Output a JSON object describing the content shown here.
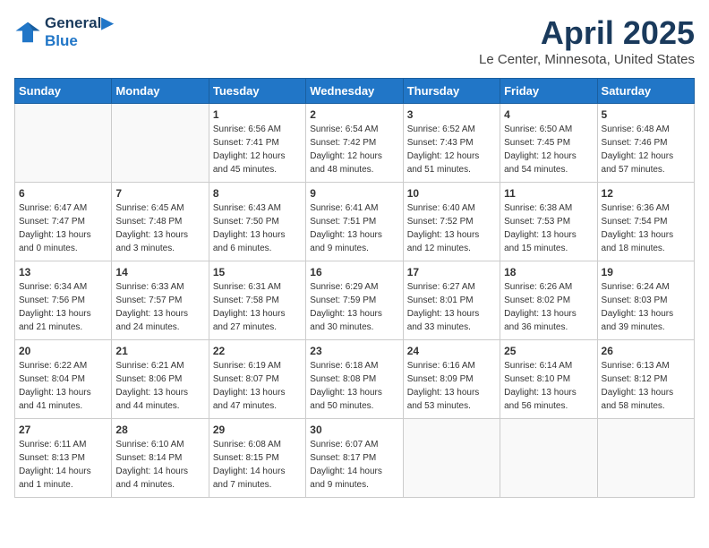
{
  "header": {
    "logo_line1": "General",
    "logo_line2": "Blue",
    "main_title": "April 2025",
    "subtitle": "Le Center, Minnesota, United States"
  },
  "days_of_week": [
    "Sunday",
    "Monday",
    "Tuesday",
    "Wednesday",
    "Thursday",
    "Friday",
    "Saturday"
  ],
  "weeks": [
    [
      {
        "day": "",
        "detail": ""
      },
      {
        "day": "",
        "detail": ""
      },
      {
        "day": "1",
        "detail": "Sunrise: 6:56 AM\nSunset: 7:41 PM\nDaylight: 12 hours and 45 minutes."
      },
      {
        "day": "2",
        "detail": "Sunrise: 6:54 AM\nSunset: 7:42 PM\nDaylight: 12 hours and 48 minutes."
      },
      {
        "day": "3",
        "detail": "Sunrise: 6:52 AM\nSunset: 7:43 PM\nDaylight: 12 hours and 51 minutes."
      },
      {
        "day": "4",
        "detail": "Sunrise: 6:50 AM\nSunset: 7:45 PM\nDaylight: 12 hours and 54 minutes."
      },
      {
        "day": "5",
        "detail": "Sunrise: 6:48 AM\nSunset: 7:46 PM\nDaylight: 12 hours and 57 minutes."
      }
    ],
    [
      {
        "day": "6",
        "detail": "Sunrise: 6:47 AM\nSunset: 7:47 PM\nDaylight: 13 hours and 0 minutes."
      },
      {
        "day": "7",
        "detail": "Sunrise: 6:45 AM\nSunset: 7:48 PM\nDaylight: 13 hours and 3 minutes."
      },
      {
        "day": "8",
        "detail": "Sunrise: 6:43 AM\nSunset: 7:50 PM\nDaylight: 13 hours and 6 minutes."
      },
      {
        "day": "9",
        "detail": "Sunrise: 6:41 AM\nSunset: 7:51 PM\nDaylight: 13 hours and 9 minutes."
      },
      {
        "day": "10",
        "detail": "Sunrise: 6:40 AM\nSunset: 7:52 PM\nDaylight: 13 hours and 12 minutes."
      },
      {
        "day": "11",
        "detail": "Sunrise: 6:38 AM\nSunset: 7:53 PM\nDaylight: 13 hours and 15 minutes."
      },
      {
        "day": "12",
        "detail": "Sunrise: 6:36 AM\nSunset: 7:54 PM\nDaylight: 13 hours and 18 minutes."
      }
    ],
    [
      {
        "day": "13",
        "detail": "Sunrise: 6:34 AM\nSunset: 7:56 PM\nDaylight: 13 hours and 21 minutes."
      },
      {
        "day": "14",
        "detail": "Sunrise: 6:33 AM\nSunset: 7:57 PM\nDaylight: 13 hours and 24 minutes."
      },
      {
        "day": "15",
        "detail": "Sunrise: 6:31 AM\nSunset: 7:58 PM\nDaylight: 13 hours and 27 minutes."
      },
      {
        "day": "16",
        "detail": "Sunrise: 6:29 AM\nSunset: 7:59 PM\nDaylight: 13 hours and 30 minutes."
      },
      {
        "day": "17",
        "detail": "Sunrise: 6:27 AM\nSunset: 8:01 PM\nDaylight: 13 hours and 33 minutes."
      },
      {
        "day": "18",
        "detail": "Sunrise: 6:26 AM\nSunset: 8:02 PM\nDaylight: 13 hours and 36 minutes."
      },
      {
        "day": "19",
        "detail": "Sunrise: 6:24 AM\nSunset: 8:03 PM\nDaylight: 13 hours and 39 minutes."
      }
    ],
    [
      {
        "day": "20",
        "detail": "Sunrise: 6:22 AM\nSunset: 8:04 PM\nDaylight: 13 hours and 41 minutes."
      },
      {
        "day": "21",
        "detail": "Sunrise: 6:21 AM\nSunset: 8:06 PM\nDaylight: 13 hours and 44 minutes."
      },
      {
        "day": "22",
        "detail": "Sunrise: 6:19 AM\nSunset: 8:07 PM\nDaylight: 13 hours and 47 minutes."
      },
      {
        "day": "23",
        "detail": "Sunrise: 6:18 AM\nSunset: 8:08 PM\nDaylight: 13 hours and 50 minutes."
      },
      {
        "day": "24",
        "detail": "Sunrise: 6:16 AM\nSunset: 8:09 PM\nDaylight: 13 hours and 53 minutes."
      },
      {
        "day": "25",
        "detail": "Sunrise: 6:14 AM\nSunset: 8:10 PM\nDaylight: 13 hours and 56 minutes."
      },
      {
        "day": "26",
        "detail": "Sunrise: 6:13 AM\nSunset: 8:12 PM\nDaylight: 13 hours and 58 minutes."
      }
    ],
    [
      {
        "day": "27",
        "detail": "Sunrise: 6:11 AM\nSunset: 8:13 PM\nDaylight: 14 hours and 1 minute."
      },
      {
        "day": "28",
        "detail": "Sunrise: 6:10 AM\nSunset: 8:14 PM\nDaylight: 14 hours and 4 minutes."
      },
      {
        "day": "29",
        "detail": "Sunrise: 6:08 AM\nSunset: 8:15 PM\nDaylight: 14 hours and 7 minutes."
      },
      {
        "day": "30",
        "detail": "Sunrise: 6:07 AM\nSunset: 8:17 PM\nDaylight: 14 hours and 9 minutes."
      },
      {
        "day": "",
        "detail": ""
      },
      {
        "day": "",
        "detail": ""
      },
      {
        "day": "",
        "detail": ""
      }
    ]
  ]
}
